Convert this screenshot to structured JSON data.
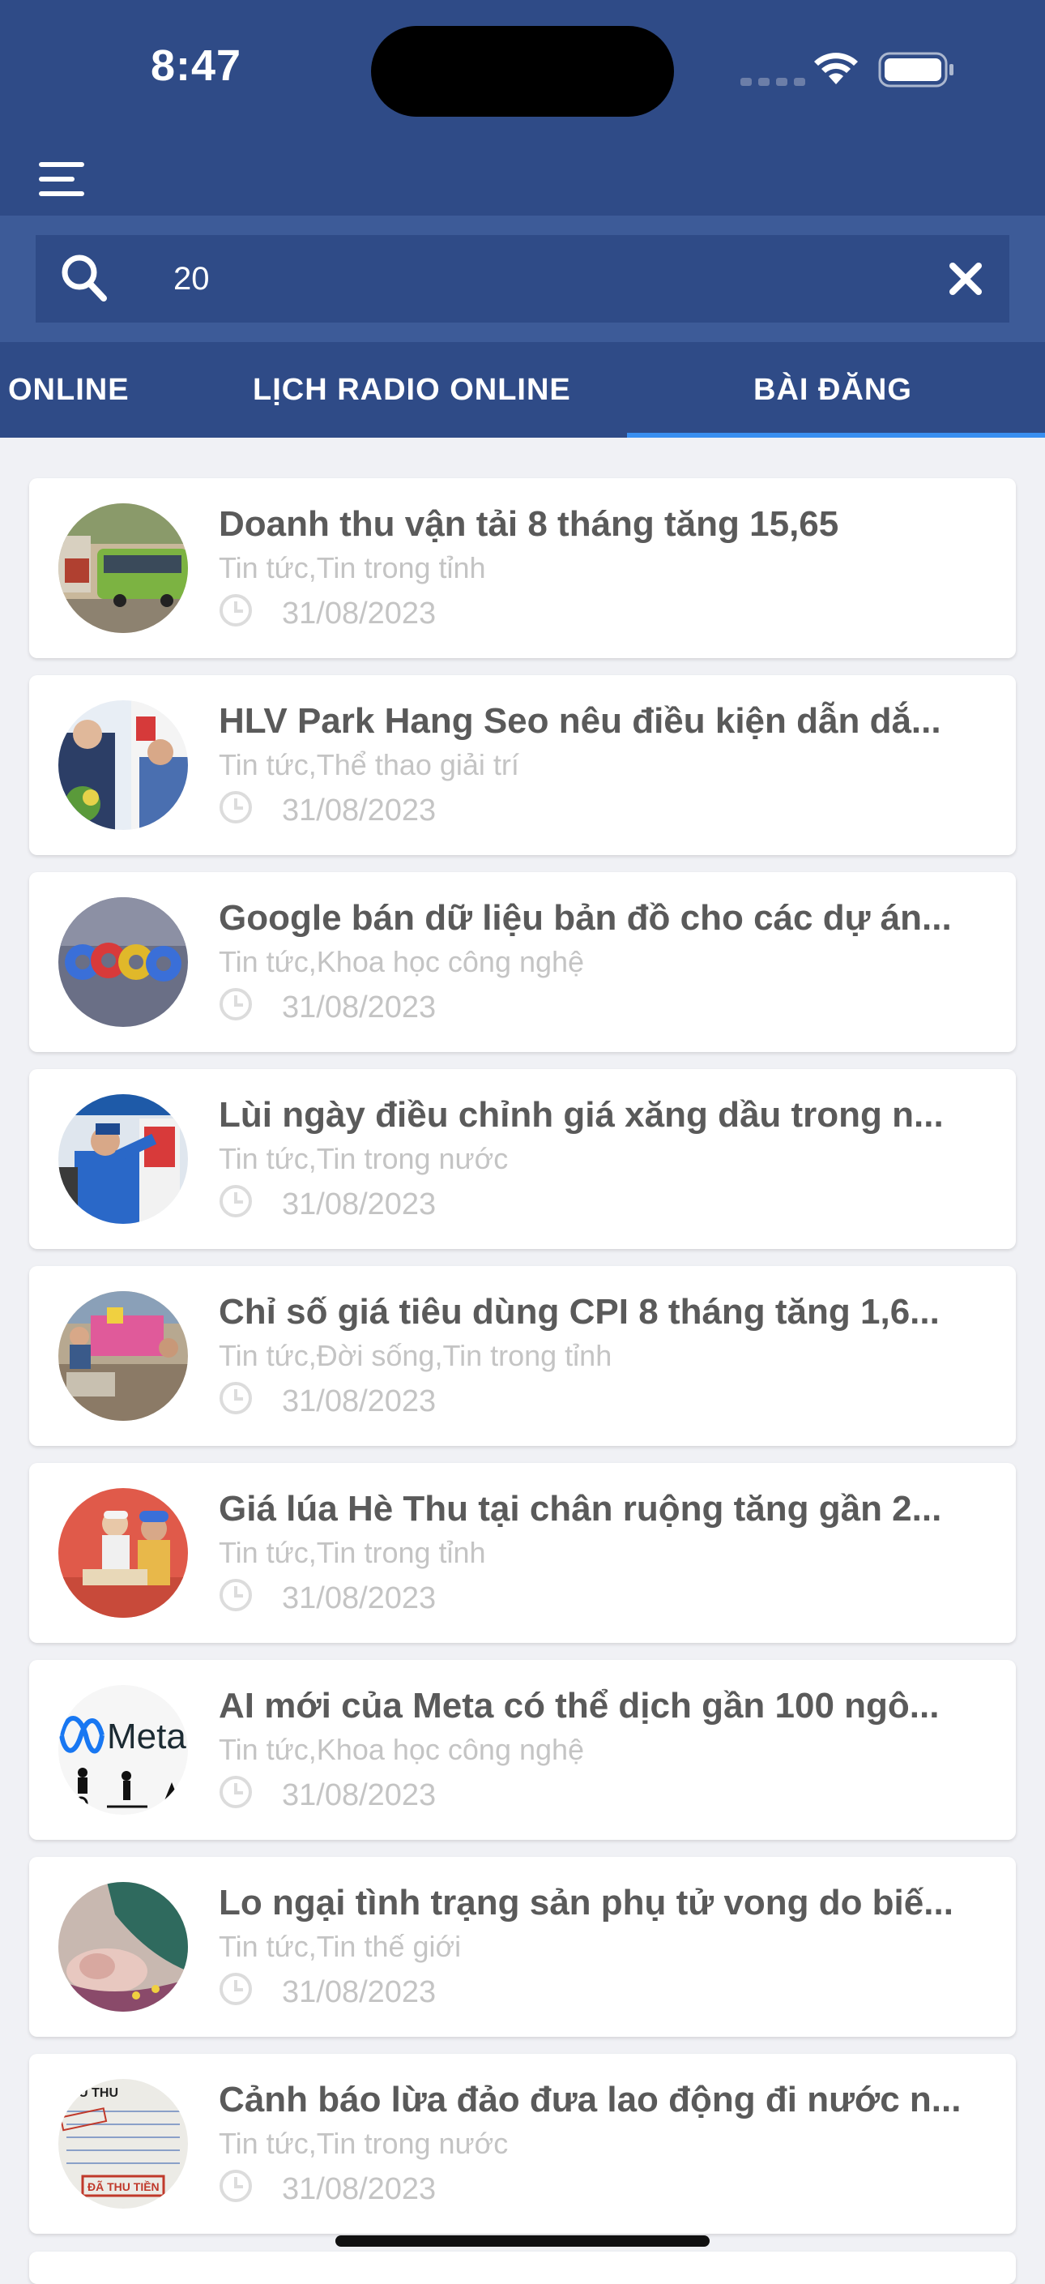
{
  "status_bar": {
    "time": "8:47"
  },
  "header": {
    "menu_icon": "hamburger-icon"
  },
  "search": {
    "value": "20",
    "icon": "search-icon",
    "clear_icon": "close-icon"
  },
  "tabs": [
    {
      "label": "ONLINE",
      "active": false
    },
    {
      "label": "LỊCH RADIO ONLINE",
      "active": false
    },
    {
      "label": "BÀI ĐĂNG",
      "active": true
    }
  ],
  "colors": {
    "header_bg": "#2f4b87",
    "search_band_bg": "#3d5b98",
    "tab_indicator": "#3a8ff0",
    "page_bg": "#f0f1f5",
    "title_text": "#5a5a5a",
    "meta_text": "#c4c4c4"
  },
  "posts": [
    {
      "title": "Doanh thu vận tải 8 tháng tăng 15,65",
      "category": "Tin tức,Tin trong tỉnh",
      "date": "31/08/2023",
      "thumb": "bus-photo"
    },
    {
      "title": "HLV Park Hang Seo nêu điều kiện dẫn dắ...",
      "category": "Tin tức,Thể thao giải trí",
      "date": "31/08/2023",
      "thumb": "coach-photo"
    },
    {
      "title": "Google bán dữ liệu bản đồ cho các dự án...",
      "category": "Tin tức,Khoa học công nghệ",
      "date": "31/08/2023",
      "thumb": "google-logo-photo"
    },
    {
      "title": "Lùi ngày điều chỉnh giá xăng dầu trong n...",
      "category": "Tin tức,Tin trong nước",
      "date": "31/08/2023",
      "thumb": "gas-station-photo"
    },
    {
      "title": "Chỉ số giá tiêu dùng CPI 8 tháng tăng 1,6...",
      "category": "Tin tức,Đời sống,Tin trong tỉnh",
      "date": "31/08/2023",
      "thumb": "market-photo"
    },
    {
      "title": "Giá lúa Hè Thu tại chân ruộng tăng gần 2...",
      "category": "Tin tức,Tin trong tỉnh",
      "date": "31/08/2023",
      "thumb": "farmers-photo"
    },
    {
      "title": "AI mới của Meta có thể dịch gần 100 ngô...",
      "category": "Tin tức,Khoa học công nghệ",
      "date": "31/08/2023",
      "thumb": "meta-logo-photo",
      "thumb_text": "Meta"
    },
    {
      "title": "Lo ngại tình trạng sản phụ tử vong do biế...",
      "category": "Tin tức,Tin thế giới",
      "date": "31/08/2023",
      "thumb": "newborn-photo"
    },
    {
      "title": "Cảnh báo lừa đảo đưa lao động đi nước n...",
      "category": "Tin tức,Tin trong nước",
      "date": "31/08/2023",
      "thumb": "document-stamp-photo",
      "thumb_text": "ĐÃ THU TIỀN",
      "thumb_header": "IEU THU"
    }
  ]
}
